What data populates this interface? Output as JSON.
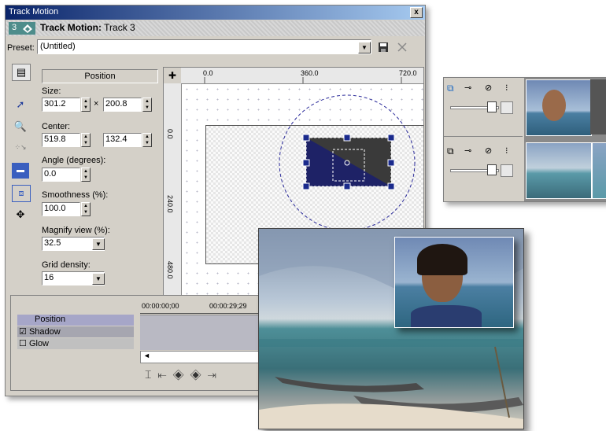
{
  "window": {
    "title": "Track Motion",
    "close_label": "x"
  },
  "header": {
    "track_number": "3",
    "title_bold": "Track Motion:",
    "title_track": "Track 3"
  },
  "preset": {
    "label": "Preset:",
    "value": "(Untitled)"
  },
  "position_panel": {
    "header": "Position",
    "size_label": "Size:",
    "size_w": "301.2",
    "size_x": "×",
    "size_h": "200.8",
    "center_label": "Center:",
    "center_x": "519.8",
    "center_y": "132.4",
    "angle_label": "Angle (degrees):",
    "angle_value": "0.0",
    "smoothness_label": "Smoothness (%):",
    "smoothness_value": "100.0",
    "magnify_label": "Magnify view (%):",
    "magnify_value": "32.5",
    "grid_label": "Grid density:",
    "grid_value": "16"
  },
  "rulers": {
    "h": [
      "0.0",
      "360.0",
      "720.0"
    ],
    "v": [
      "0.0",
      "240.0",
      "480.0"
    ]
  },
  "timeline": {
    "times": [
      "00:00:00;00",
      "00:00:29;29"
    ],
    "rows": [
      {
        "label": "Position",
        "checkbox": false
      },
      {
        "label": "Shadow",
        "checkbox": true,
        "checked": true
      },
      {
        "label": "Glow",
        "checkbox": true,
        "checked": false
      }
    ],
    "box_icon_label": "a"
  },
  "colors": {
    "titlebar_start": "#0a246a",
    "titlebar_end": "#a6caf0",
    "track_badge": "#4e8d8b",
    "motion_box": "#1e2266",
    "handle": "#1a2a8c"
  }
}
